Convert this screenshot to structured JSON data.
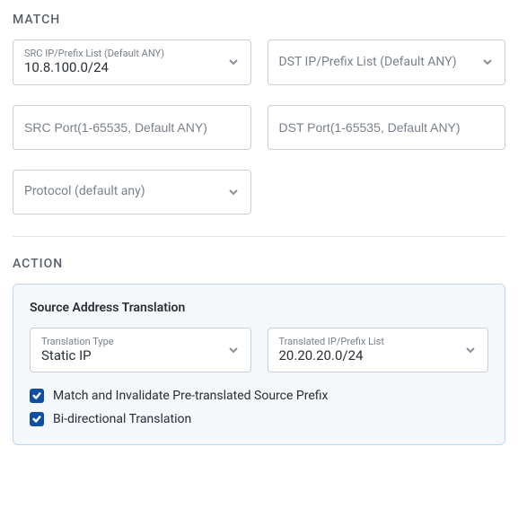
{
  "match": {
    "title": "MATCH",
    "src_ip": {
      "label": "SRC IP/Prefix List (Default ANY)",
      "value": "10.8.100.0/24"
    },
    "dst_ip": {
      "placeholder": "DST IP/Prefix List (Default ANY)"
    },
    "src_port": {
      "placeholder": "SRC Port(1-65535, Default ANY)"
    },
    "dst_port": {
      "placeholder": "DST Port(1-65535, Default ANY)"
    },
    "protocol": {
      "placeholder": "Protocol (default any)"
    }
  },
  "action": {
    "title": "ACTION",
    "sat": {
      "heading": "Source Address Translation",
      "translation_type": {
        "label": "Translation Type",
        "value": "Static IP"
      },
      "translated_list": {
        "label": "Translated IP/Prefix List",
        "value": "20.20.20.0/24"
      },
      "match_invalidate": {
        "label": "Match and Invalidate Pre-translated Source Prefix",
        "checked": true
      },
      "bidirectional": {
        "label": "Bi-directional Translation",
        "checked": true
      }
    }
  }
}
